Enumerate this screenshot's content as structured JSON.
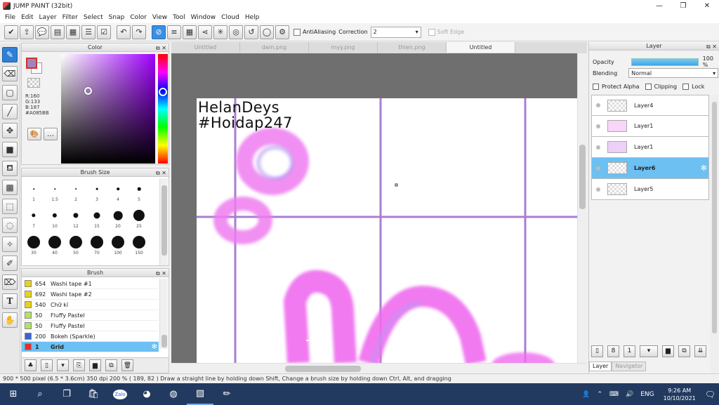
{
  "window": {
    "title": "JUMP PAINT (32bit)",
    "controls": [
      "—",
      "❐",
      "✕"
    ]
  },
  "menu": [
    "File",
    "Edit",
    "Layer",
    "Filter",
    "Select",
    "Snap",
    "Color",
    "View",
    "Tool",
    "Window",
    "Cloud",
    "Help"
  ],
  "toolbar": {
    "antialiasing_label": "AntiAliasing",
    "correction_label": "Correction",
    "correction_value": "2",
    "soft_edge_label": "Soft Edge"
  },
  "color_panel": {
    "title": "Color",
    "r": "R:160",
    "g": "G:133",
    "b": "B:187",
    "hex": "#A085BB",
    "current_color": "#a085bb"
  },
  "brush_size_panel": {
    "title": "Brush Size",
    "sizes": [
      {
        "label": "1",
        "d": 1
      },
      {
        "label": "1.5",
        "d": 1.5
      },
      {
        "label": "2",
        "d": 2
      },
      {
        "label": "3",
        "d": 3
      },
      {
        "label": "4",
        "d": 4
      },
      {
        "label": "5",
        "d": 5
      },
      {
        "label": "7",
        "d": 6
      },
      {
        "label": "10",
        "d": 7
      },
      {
        "label": "12",
        "d": 8
      },
      {
        "label": "15",
        "d": 10
      },
      {
        "label": "20",
        "d": 14
      },
      {
        "label": "25",
        "d": 18
      },
      {
        "label": "30",
        "d": 20
      },
      {
        "label": "40",
        "d": 20
      },
      {
        "label": "50",
        "d": 20
      },
      {
        "label": "70",
        "d": 20
      },
      {
        "label": "100",
        "d": 20
      },
      {
        "label": "150",
        "d": 20
      }
    ]
  },
  "brush_panel": {
    "title": "Brush",
    "items": [
      {
        "num": "654",
        "name": "Washi tape #1",
        "color": "#e8d21a"
      },
      {
        "num": "692",
        "name": "Washi tape #2",
        "color": "#e8d21a"
      },
      {
        "num": "540",
        "name": "Chữ kí",
        "color": "#e8d21a"
      },
      {
        "num": "50",
        "name": "Fluffy Pastel",
        "color": "#b5e06a"
      },
      {
        "num": "50",
        "name": "Fluffy Pastel",
        "color": "#b5e06a"
      },
      {
        "num": "200",
        "name": "Bokeh (Sparkle)",
        "color": "#3a62d6"
      },
      {
        "num": "1",
        "name": "Grid",
        "color": "#e03030"
      }
    ]
  },
  "document_tabs": [
    "Untitled",
    "dam.png",
    "myy.png",
    "thien.png",
    "Untitled"
  ],
  "canvas": {
    "caption_line1": "HelanDeys",
    "caption_line2": "#Hoidap247"
  },
  "layer_panel": {
    "title": "Layer",
    "opacity_label": "Opacity",
    "opacity_value": "100 %",
    "blending_label": "Blending",
    "blending_value": "Normal",
    "protect_alpha": "Protect Alpha",
    "clipping": "Clipping",
    "lock": "Lock",
    "layers": [
      "Layer4",
      "Layer1",
      "Layer1",
      "Layer6",
      "Layer5"
    ],
    "tab_layer": "Layer",
    "tab_navigator": "Navigator"
  },
  "status": "900 * 500 pixel  (6.5 * 3.6cm)  350 dpi  200 %  ( 189, 82 )  Draw a straight line by holding down Shift, Change a brush size by holding down Ctrl, Alt, and dragging",
  "taskbar": {
    "lang": "ENG",
    "time": "9:26 AM",
    "date": "10/10/2021",
    "zalo": "Zalo"
  }
}
